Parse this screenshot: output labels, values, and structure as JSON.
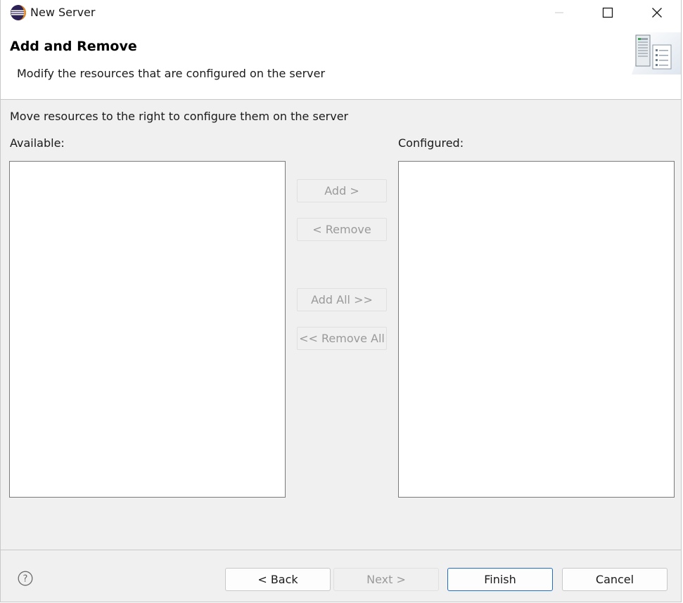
{
  "window": {
    "title": "New Server",
    "controls": {
      "minimize_icon": "minimize-icon",
      "maximize_icon": "maximize-icon",
      "close_icon": "close-icon"
    }
  },
  "banner": {
    "title": "Add and Remove",
    "description": "Modify the resources that are configured on the server"
  },
  "main": {
    "instruction": "Move resources to the right to configure them on the server",
    "available_label": "Available:",
    "configured_label": "Configured:",
    "available_items": [],
    "configured_items": [],
    "buttons": {
      "add": "Add >",
      "remove": "< Remove",
      "add_all": "Add All >>",
      "remove_all": "<< Remove All"
    }
  },
  "footer": {
    "help_icon": "help-icon",
    "back": "< Back",
    "next": "Next >",
    "finish": "Finish",
    "cancel": "Cancel"
  },
  "colors": {
    "accent": "#1f6fc8",
    "disabled_text": "#9a9a9a",
    "dialog_bg": "#f0f0f0"
  }
}
